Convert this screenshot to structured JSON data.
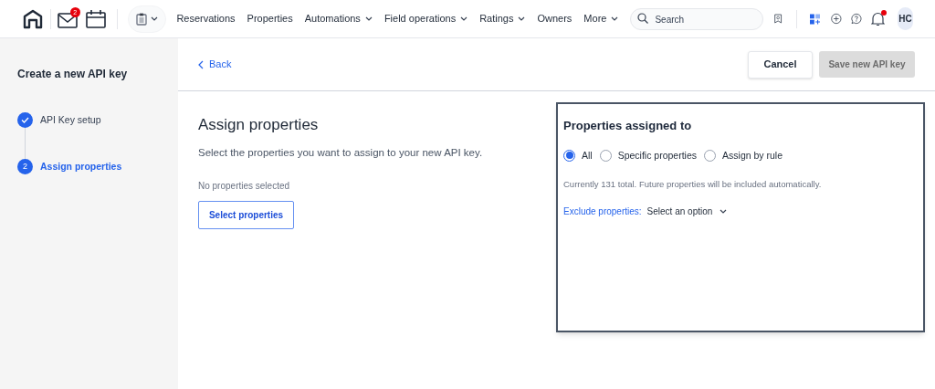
{
  "nav": {
    "mail_badge": "2",
    "menu": [
      {
        "label": "Reservations",
        "dropdown": false
      },
      {
        "label": "Properties",
        "dropdown": false
      },
      {
        "label": "Automations",
        "dropdown": true
      },
      {
        "label": "Field operations",
        "dropdown": true
      },
      {
        "label": "Ratings",
        "dropdown": true
      },
      {
        "label": "Owners",
        "dropdown": false
      },
      {
        "label": "More",
        "dropdown": true
      }
    ],
    "search": {
      "placeholder": "Search"
    },
    "notification_alert": true,
    "avatar": "HC"
  },
  "sidebar": {
    "title": "Create a new API key",
    "steps": [
      {
        "label": "API Key setup",
        "done": true,
        "selected": false
      },
      {
        "label": "Assign properties",
        "number": "2",
        "done": false,
        "selected": true
      }
    ]
  },
  "header": {
    "back": "Back",
    "cancel": "Cancel",
    "save": {
      "label": "Save new API key",
      "disabled": true
    }
  },
  "content": {
    "title": "Assign properties",
    "subtitle": "Select the properties you want to assign to your new API key.",
    "empty_text": "No properties selected",
    "select_button": "Select properties"
  },
  "panel": {
    "title": "Properties assigned to",
    "options": [
      {
        "label": "All",
        "selected": true
      },
      {
        "label": "Specific properties",
        "selected": false
      },
      {
        "label": "Assign by rule",
        "selected": false
      }
    ],
    "note": "Currently 131 total. Future properties will be included automatically.",
    "exclude_label": "Exclude properties:",
    "exclude_value": "Select an option"
  }
}
